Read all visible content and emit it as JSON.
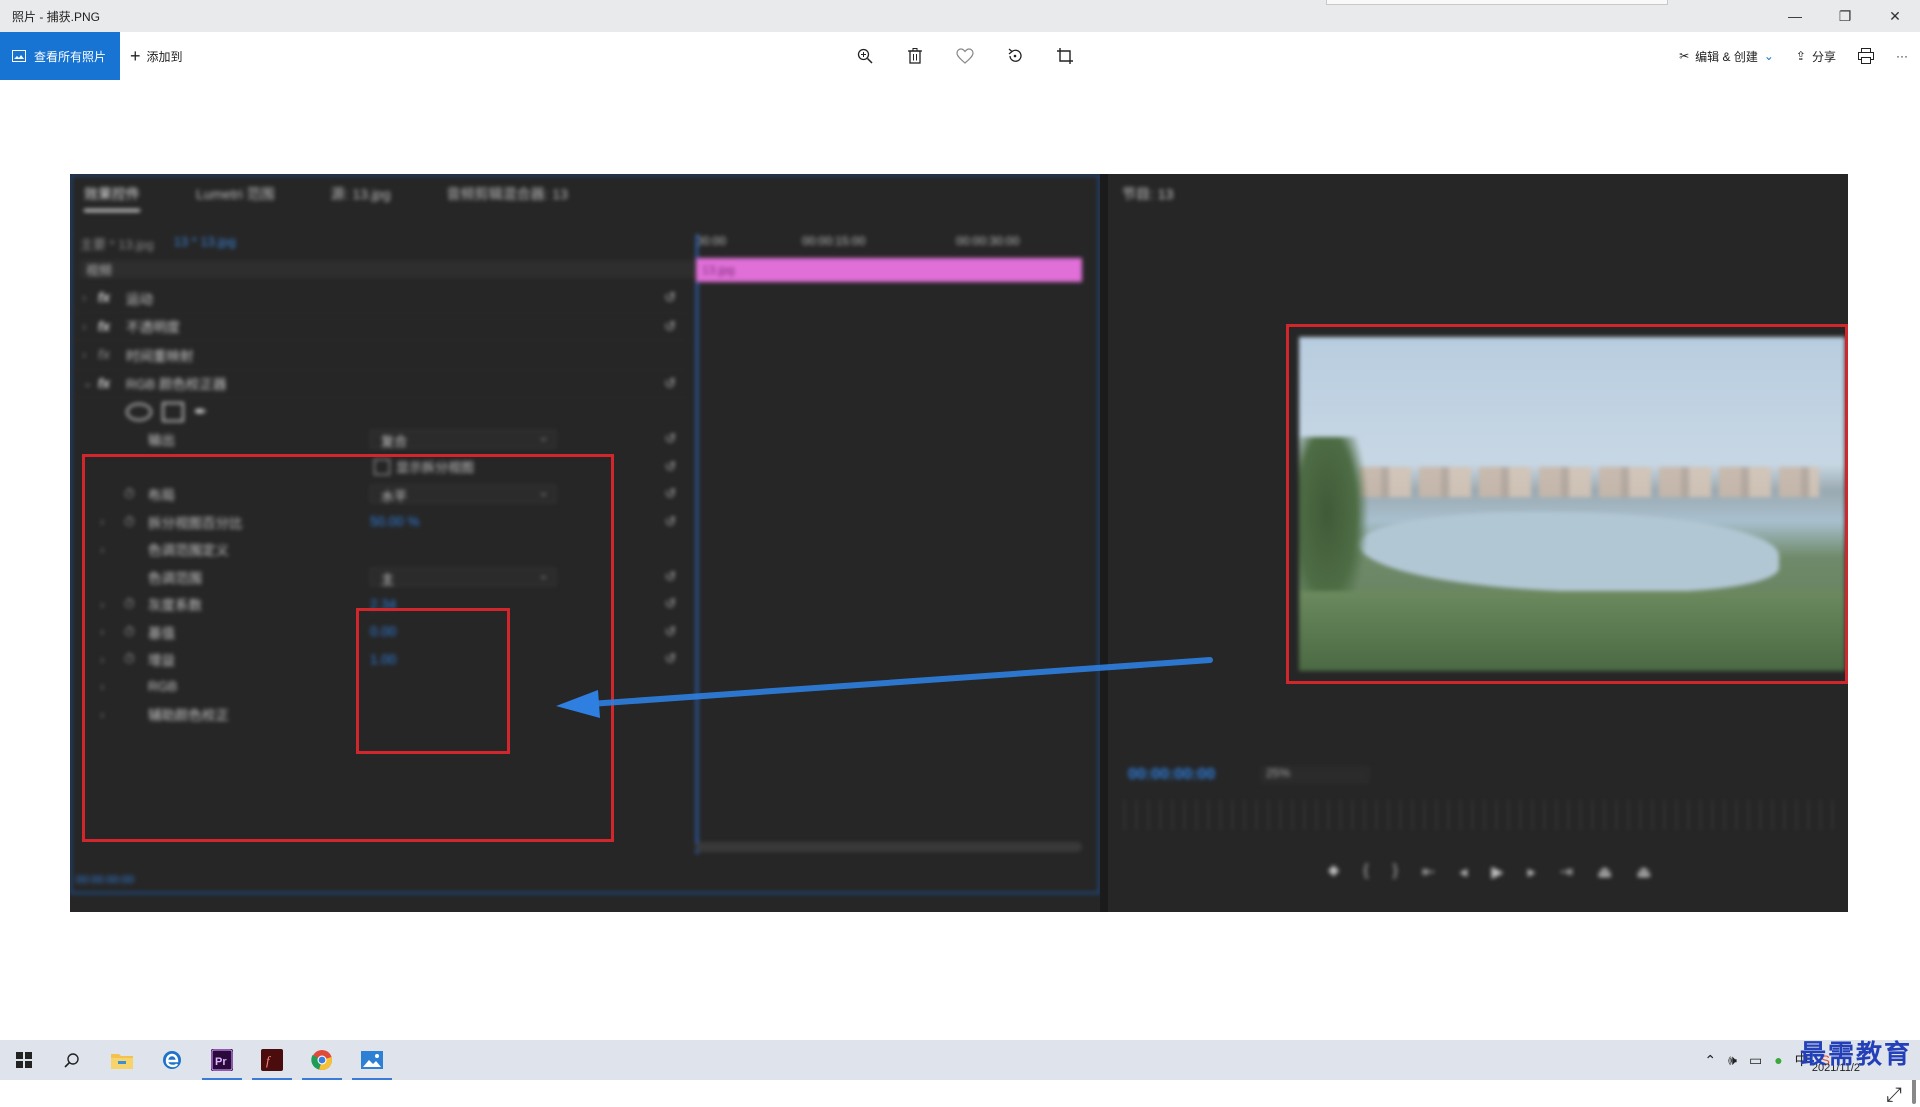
{
  "window": {
    "title": "照片 - 捕获.PNG",
    "controls": {
      "minimize": "—",
      "maximize": "❐",
      "close": "✕"
    }
  },
  "toolbar": {
    "view_all_label": "查看所有照片",
    "add_label": "添加到",
    "center_icons": [
      "zoom-in-icon",
      "delete-icon",
      "favorite-icon",
      "rotate-icon",
      "crop-icon"
    ],
    "edit_create_label": "编辑 & 创建",
    "share_label": "分享",
    "more_label": "···"
  },
  "screenshot": {
    "left_panel": {
      "tabs": [
        "效果控件",
        "Lumetri 范围",
        "源: 13.jpg",
        "音频剪辑混合器: 13"
      ],
      "source_label": "主要 * 13.jpg",
      "sequence_label": "13 * 13.jpg",
      "video_label": "视频",
      "effects": [
        {
          "name": "运动",
          "fx": "fx"
        },
        {
          "name": "不透明度",
          "fx": "fx"
        },
        {
          "name": "时间重映射",
          "fx": "fx"
        },
        {
          "name": "RGB 颜色校正器",
          "fx": "fx"
        }
      ],
      "props": {
        "output_label": "输出",
        "output_value": "复合",
        "show_split_label": "显示拆分视图",
        "layout_label": "布局",
        "layout_value": "水平",
        "split_percent_label": "拆分视图百分比",
        "split_percent_value": "50.00 %",
        "tonal_range_def_label": "色调范围定义",
        "tonal_range_label": "色调范围",
        "tonal_range_value": "主",
        "gamma_label": "灰度系数",
        "gamma_value": "2.34",
        "pedestal_label": "基值",
        "pedestal_value": "0.00",
        "gain_label": "增益",
        "gain_value": "1.00",
        "rgb_label": "RGB",
        "secondary_label": "辅助颜色校正"
      },
      "bottom_timecode": "00:00:00:00"
    },
    "timeline": {
      "ruler": [
        "00:00",
        "00:00:15:00",
        "00:00:30:00"
      ],
      "clip_label": "13.jpg"
    },
    "program": {
      "title": "节目: 13",
      "timecode": "00:00:00:00",
      "zoom": "25%",
      "controls": [
        "marker-icon",
        "in-point-icon",
        "out-point-icon",
        "go-to-in-icon",
        "step-back-icon",
        "play-icon",
        "step-forward-icon",
        "go-to-out-icon",
        "lift-icon",
        "extract-icon"
      ]
    },
    "colors": {
      "highlight_red": "#d1262b",
      "arrow_blue": "#2f7fe0",
      "clip_pink": "#e070d8"
    }
  },
  "taskbar": {
    "apps": [
      "windows-start-icon",
      "search-icon",
      "file-explorer-icon",
      "edge-icon",
      "premiere-icon",
      "flash-icon",
      "chrome-icon",
      "photos-icon"
    ],
    "clock_date": "2021/11/2",
    "watermark": "最需教育"
  }
}
